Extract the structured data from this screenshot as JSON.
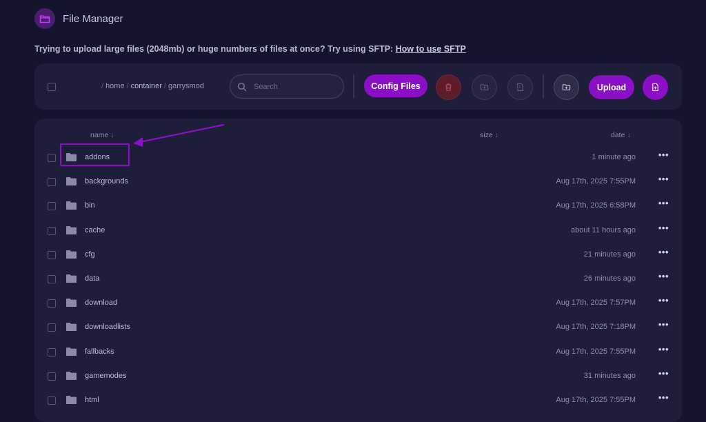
{
  "app": {
    "title": "File Manager",
    "icon": "folder-open-icon",
    "accent": "#8b0fc7"
  },
  "notice": {
    "text": "Trying to upload large files (2048mb) or huge numbers of files at once? Try using SFTP: ",
    "link": "How to use SFTP"
  },
  "breadcrumb": {
    "sep": "/",
    "segments": [
      "home",
      "container"
    ],
    "current": "garrysmod"
  },
  "search": {
    "placeholder": "Search",
    "value": ""
  },
  "toolbar": {
    "config_label": "Config Files",
    "upload_label": "Upload"
  },
  "columns": {
    "name": "name",
    "size": "size",
    "date": "date",
    "sort_glyph": "↓"
  },
  "files": [
    {
      "name": "addons",
      "date": "1 minute ago"
    },
    {
      "name": "backgrounds",
      "date": "Aug 17th, 2025 7:55PM"
    },
    {
      "name": "bin",
      "date": "Aug 17th, 2025 6:58PM"
    },
    {
      "name": "cache",
      "date": "about 11 hours ago"
    },
    {
      "name": "cfg",
      "date": "21 minutes ago"
    },
    {
      "name": "data",
      "date": "26 minutes ago"
    },
    {
      "name": "download",
      "date": "Aug 17th, 2025 7:57PM"
    },
    {
      "name": "downloadlists",
      "date": "Aug 17th, 2025 7:18PM"
    },
    {
      "name": "fallbacks",
      "date": "Aug 17th, 2025 7:55PM"
    },
    {
      "name": "gamemodes",
      "date": "31 minutes ago"
    },
    {
      "name": "html",
      "date": "Aug 17th, 2025 7:55PM"
    }
  ],
  "row_menu_glyph": "•••"
}
